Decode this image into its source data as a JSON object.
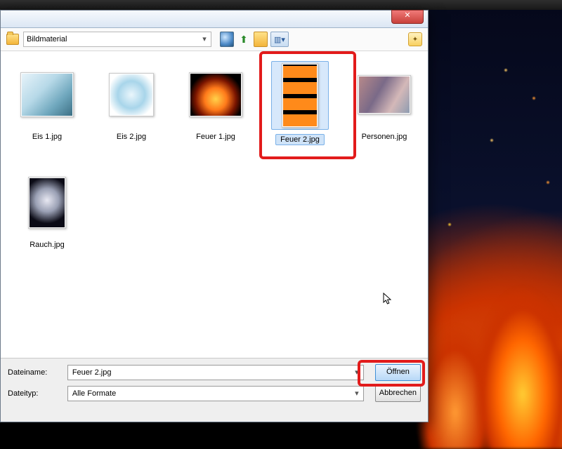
{
  "folder": "Bildmaterial",
  "files": [
    {
      "name": "Eis 1.jpg",
      "sel": false,
      "kind": "ice1"
    },
    {
      "name": "Eis 2.jpg",
      "sel": false,
      "kind": "ice2"
    },
    {
      "name": "Feuer 1.jpg",
      "sel": false,
      "kind": "fire1"
    },
    {
      "name": "Feuer 2.jpg",
      "sel": true,
      "kind": "fire2"
    },
    {
      "name": "Personen.jpg",
      "sel": false,
      "kind": "people"
    },
    {
      "name": "Rauch.jpg",
      "sel": false,
      "kind": "smoke"
    }
  ],
  "filename_label": "Dateiname:",
  "filetype_label": "Dateityp:",
  "filename_value": "Feuer 2.jpg",
  "filetype_value": "Alle Formate",
  "open": "Öffnen",
  "cancel": "Abbrechen",
  "close_glyph": "✕",
  "view_glyph": "▥▾",
  "star_glyph": "✦",
  "arrow": "▾",
  "up_glyph": "⬆"
}
